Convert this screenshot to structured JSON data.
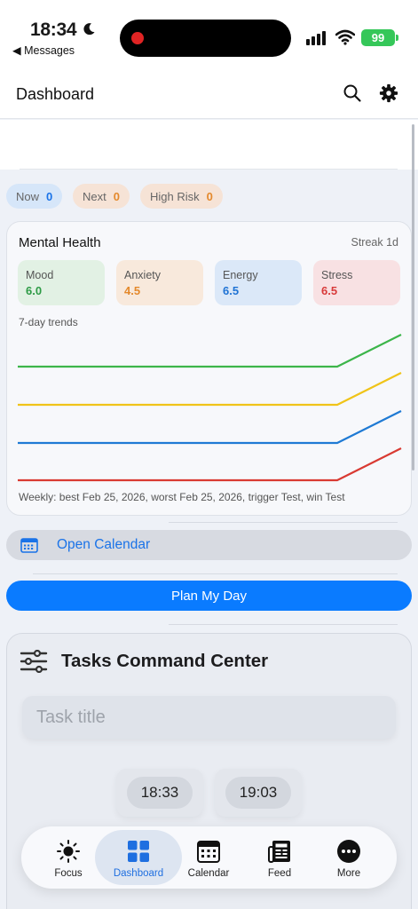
{
  "status_bar": {
    "time": "18:34",
    "back_label": "◀ Messages",
    "battery": "99"
  },
  "header": {
    "title": "Dashboard"
  },
  "pills": [
    {
      "label": "Now",
      "count": "0"
    },
    {
      "label": "Next",
      "count": "0"
    },
    {
      "label": "High Risk",
      "count": "0"
    }
  ],
  "mental_health": {
    "title": "Mental Health",
    "streak": "Streak 1d",
    "metrics": [
      {
        "label": "Mood",
        "value": "6.0",
        "color": "#2e9b46",
        "bg": "#e2f1e4"
      },
      {
        "label": "Anxiety",
        "value": "4.5",
        "color": "#e4892c",
        "bg": "#f8e9dc"
      },
      {
        "label": "Energy",
        "value": "6.5",
        "color": "#1f73d4",
        "bg": "#dbe8f8"
      },
      {
        "label": "Stress",
        "value": "6.5",
        "color": "#d83a3a",
        "bg": "#f8e1e3"
      }
    ],
    "trends_label": "7-day trends",
    "weekly_summary": "Weekly: best Feb 25, 2026, worst Feb 25, 2026, trigger Test, win Test"
  },
  "chart_data": {
    "type": "line",
    "x": [
      1,
      2,
      3,
      4,
      5,
      6,
      7
    ],
    "series": [
      {
        "values": [
          6.0,
          6.0,
          6.0,
          6.0,
          6.0,
          6.0,
          7.0
        ],
        "color": "#3cb54a"
      },
      {
        "values": [
          4.5,
          4.5,
          4.5,
          4.5,
          4.5,
          4.5,
          5.5
        ],
        "color": "#f0c419"
      },
      {
        "values": [
          6.5,
          6.5,
          6.5,
          6.5,
          6.5,
          6.5,
          7.5
        ],
        "color": "#1f7ad4"
      },
      {
        "values": [
          6.5,
          6.5,
          6.5,
          6.5,
          6.5,
          6.5,
          7.5
        ],
        "color": "#d93a32"
      }
    ]
  },
  "actions": {
    "open_calendar": "Open Calendar",
    "plan_day": "Plan My Day"
  },
  "tasks": {
    "title": "Tasks Command Center",
    "input_placeholder": "Task title",
    "start_time": "18:33",
    "end_time": "19:03"
  },
  "tab_bar": [
    {
      "label": "Focus",
      "icon": "sun-icon"
    },
    {
      "label": "Dashboard",
      "icon": "grid-icon",
      "active": true
    },
    {
      "label": "Calendar",
      "icon": "calendar-icon"
    },
    {
      "label": "Feed",
      "icon": "newspaper-icon"
    },
    {
      "label": "More",
      "icon": "more-icon"
    }
  ],
  "colors": {
    "accent": "#0a7bff",
    "link": "#1a73e8"
  }
}
